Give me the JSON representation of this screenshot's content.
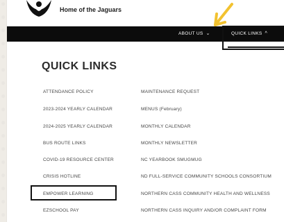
{
  "header": {
    "site_name": "Home of the Jaguars"
  },
  "nav": {
    "about_label": "ABOUT US",
    "quick_label": "QUICK LINKS",
    "about_icon": "chevron-down-icon",
    "quick_icon": "chevron-up-icon"
  },
  "main": {
    "heading": "QUICK LINKS",
    "column1": [
      "ATTENDANCE POLICY",
      "2023-2024 YEARLY CALENDAR",
      "2024-2025 YEARLY CALENDAR",
      "BUS ROUTE LINKS",
      "COVID-19 RESOURCE CENTER",
      "CRISIS HOTLINE",
      "EMPOWER LEARNING",
      "EZSCHOOL PAY"
    ],
    "column2": [
      "MAINTENANCE REQUEST",
      "MENUS (February)",
      "MONTHLY CALENDAR",
      "MONTHLY NEWSLETTER",
      "NC YEARBOOK SMUGMUG",
      "ND FULL-SERVICE COMMUNITY SCHOOLS CONSORTIUM",
      "NORTHERN CASS COMMUNITY HEALTH AND WELLNESS",
      "NORTHERN CASS INQUIRY AND/OR COMPLAINT FORM"
    ]
  },
  "colors": {
    "navbar": "#0c0c0c",
    "annotation_arrow": "#f2c230"
  }
}
